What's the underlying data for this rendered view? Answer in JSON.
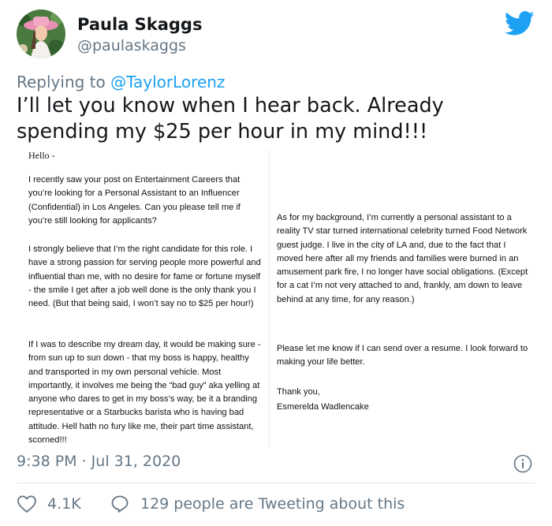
{
  "author": {
    "display_name": "Paula Skaggs",
    "handle": "@paulaskaggs"
  },
  "reply": {
    "prefix": "Replying to ",
    "mention": "@TaylorLorenz"
  },
  "tweet": {
    "text": "I’ll let you know when I hear back. Already spending my $25 per hour in my mind!!!",
    "timestamp": "9:38 PM · Jul 31, 2020"
  },
  "letter": {
    "left": {
      "greeting": "Hello -",
      "p1": "I recently saw your post on Entertainment Careers that you’re looking for a Personal Assistant to an Influencer (Confidential) in Los Angeles. Can you please tell me if you’re still looking for applicants?",
      "p2": "I strongly believe that I’m the right candidate for this role. I have a strong passion for serving people more powerful and influential than me, with no desire for fame or fortune myself - the smile I get after a job well done is the only thank you I need. (But that being said, I won’t say no to $25 per hour!)",
      "p3": "If I was to describe my dream day, it would be making sure - from sun up to sun down - that my boss is happy, healthy and transported in my own personal vehicle. Most importantly, it involves me being the “bad guy” aka yelling at anyone who dares to get in my boss’s way, be it a branding representative or a Starbucks barista who is having bad attitude. Hell hath no fury like me, their part time assistant, scorned!!!"
    },
    "right": {
      "p1": "As for my background, I’m currently a personal assistant to a reality TV star turned international celebrity turned Food Network guest judge. I live in the city of LA and, due to the fact that I moved here after all my friends and families were burned in an amusement park fire, I no longer have social obligations. (Except for a cat I’m not very attached to and, frankly, am down to leave behind at any time, for any reason.)",
      "p2": "Please let me know if I can send over a resume. I look forward to making your life better.",
      "closing": "Thank you,",
      "signature": "Esmerelda Wadlencake"
    }
  },
  "actions": {
    "likes": "4.1K",
    "conversation": "129 people are Tweeting about this"
  },
  "icons": {
    "brand": "twitter-bird-icon",
    "info": "info-icon",
    "like": "heart-icon",
    "reply": "speech-bubble-icon"
  },
  "colors": {
    "brand_blue": "#1da1f2",
    "secondary_text": "#657786",
    "primary_text": "#14171a",
    "divider": "#e1e8ed"
  }
}
